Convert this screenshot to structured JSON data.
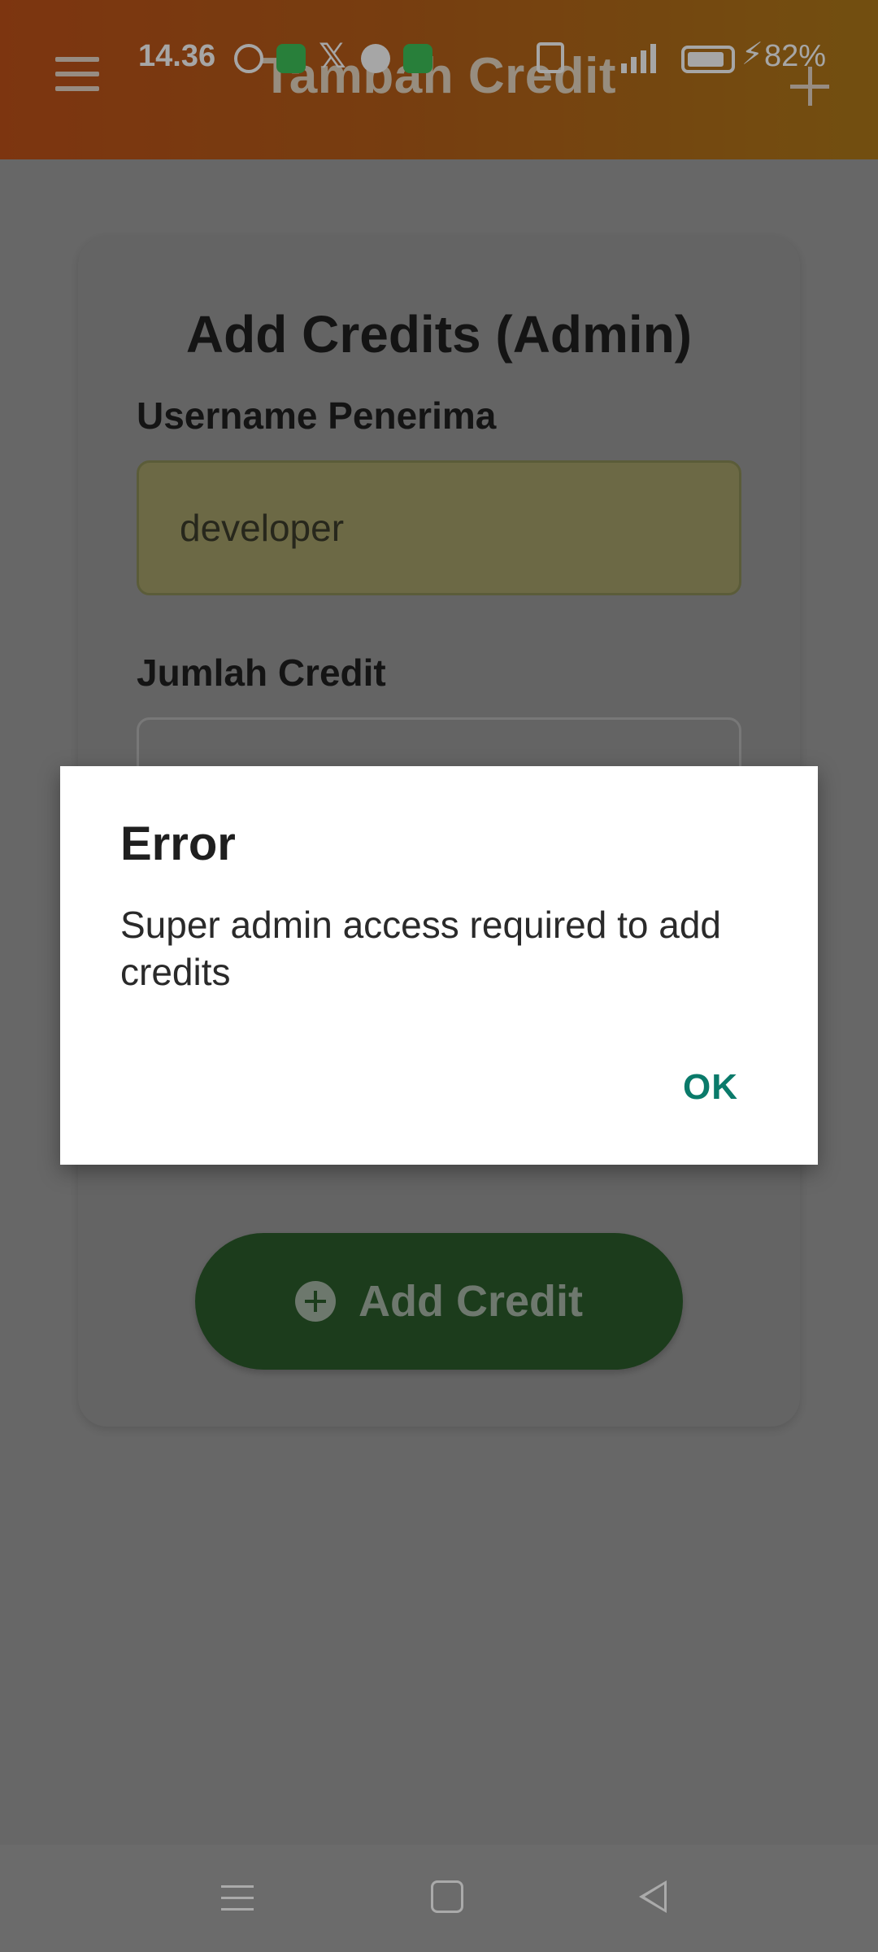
{
  "status_bar": {
    "time": "14.36",
    "battery": "82%"
  },
  "app_bar": {
    "title": "Tambah Credit",
    "menu_icon": "hamburger-menu-icon",
    "action_icon": "plus-icon"
  },
  "form": {
    "title": "Add Credits (Admin)",
    "username_label": "Username Penerima",
    "username_value": "developer",
    "amount_label": "Jumlah Credit",
    "amount_value": "",
    "submit_label": "Add Credit",
    "submit_icon": "plus-circle-icon"
  },
  "dialog": {
    "title": "Error",
    "message": "Super admin access required to add credits",
    "ok_label": "OK"
  },
  "colors": {
    "appbar_gradient_start": "#c0521a",
    "appbar_gradient_end": "#b07a1a",
    "submit_button": "#2c5d2c",
    "dialog_action": "#0a7a6a"
  }
}
